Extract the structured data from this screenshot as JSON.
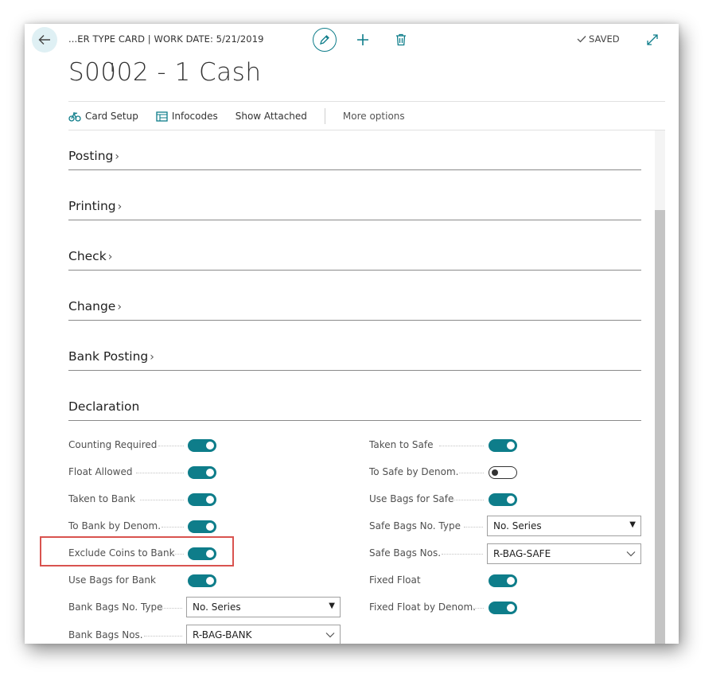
{
  "header": {
    "breadcrumb": "...ER TYPE CARD | WORK DATE: 5/21/2019",
    "saved_label": "SAVED",
    "title": "S0002 - 1 Cash"
  },
  "actions": {
    "card_setup": "Card Setup",
    "infocodes": "Infocodes",
    "show_attached": "Show Attached",
    "more_options": "More options"
  },
  "sections": [
    {
      "label": "Posting",
      "collapsed": true
    },
    {
      "label": "Printing",
      "collapsed": true
    },
    {
      "label": "Check",
      "collapsed": true
    },
    {
      "label": "Change",
      "collapsed": true
    },
    {
      "label": "Bank Posting",
      "collapsed": true
    },
    {
      "label": "Declaration",
      "collapsed": false
    }
  ],
  "declaration": {
    "left": [
      {
        "label": "Counting Required",
        "type": "toggle",
        "value": true
      },
      {
        "label": "Float Allowed",
        "type": "toggle",
        "value": true
      },
      {
        "label": "Taken to Bank",
        "type": "toggle",
        "value": true
      },
      {
        "label": "To Bank by Denom.",
        "type": "toggle",
        "value": true
      },
      {
        "label": "Exclude Coins to Bank",
        "type": "toggle",
        "value": true
      },
      {
        "label": "Use Bags for Bank",
        "type": "toggle",
        "value": true
      },
      {
        "label": "Bank Bags No. Type",
        "type": "select",
        "value": "No. Series"
      },
      {
        "label": "Bank Bags Nos.",
        "type": "lookup",
        "value": "R-BAG-BANK"
      }
    ],
    "right": [
      {
        "label": "Taken to Safe",
        "type": "toggle",
        "value": true
      },
      {
        "label": "To Safe by Denom.",
        "type": "toggle",
        "value": false
      },
      {
        "label": "Use Bags for Safe",
        "type": "toggle",
        "value": true
      },
      {
        "label": "Safe Bags No. Type",
        "type": "select",
        "value": "No. Series"
      },
      {
        "label": "Safe Bags Nos.",
        "type": "lookup",
        "value": "R-BAG-SAFE"
      },
      {
        "label": "Fixed Float",
        "type": "toggle",
        "value": true
      },
      {
        "label": "Fixed Float by Denom.",
        "type": "toggle",
        "value": true
      }
    ]
  },
  "colors": {
    "accent": "#0e7d8a",
    "highlight": "#d9534f"
  }
}
